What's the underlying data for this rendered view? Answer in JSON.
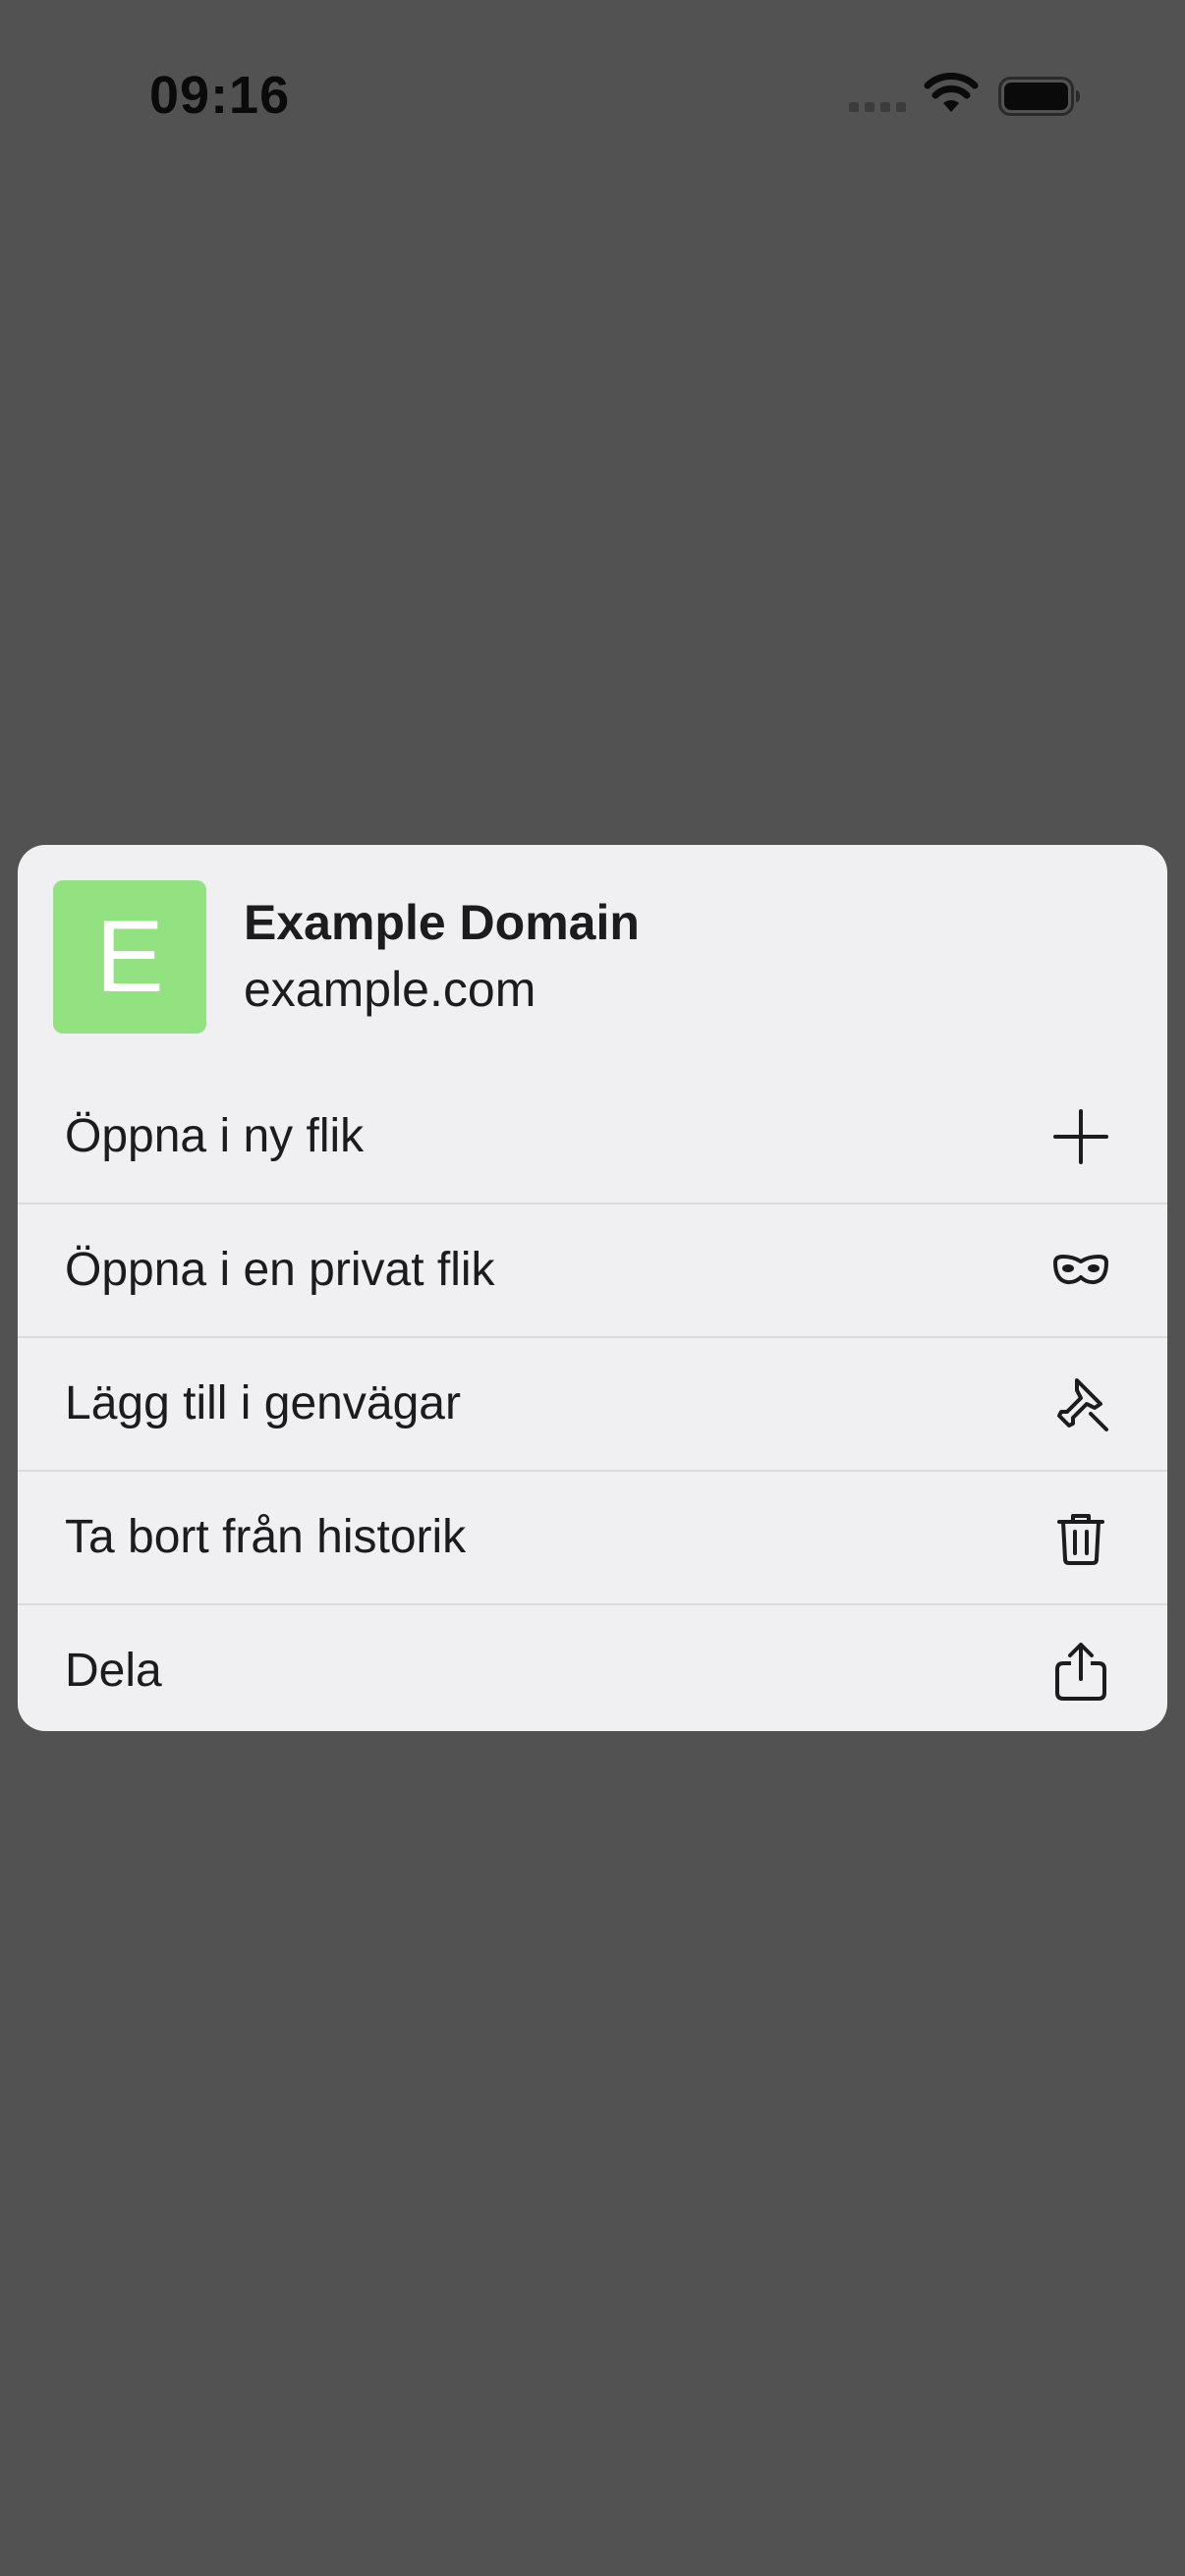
{
  "status_bar": {
    "time": "09:16"
  },
  "context_menu": {
    "preview": {
      "favicon_letter": "E",
      "favicon_color": "#93e281",
      "title": "Example Domain",
      "url": "example.com"
    },
    "items": [
      {
        "label": "Öppna i ny flik",
        "icon": "plus-icon"
      },
      {
        "label": "Öppna i en privat flik",
        "icon": "private-mask-icon"
      },
      {
        "label": "Lägg till i genvägar",
        "icon": "pin-icon"
      },
      {
        "label": "Ta bort från historik",
        "icon": "trash-icon"
      },
      {
        "label": "Dela",
        "icon": "share-icon"
      }
    ]
  },
  "colors": {
    "overlay_background": "#525252",
    "menu_background": "#f0f0f2",
    "text": "#1c1c1e"
  }
}
